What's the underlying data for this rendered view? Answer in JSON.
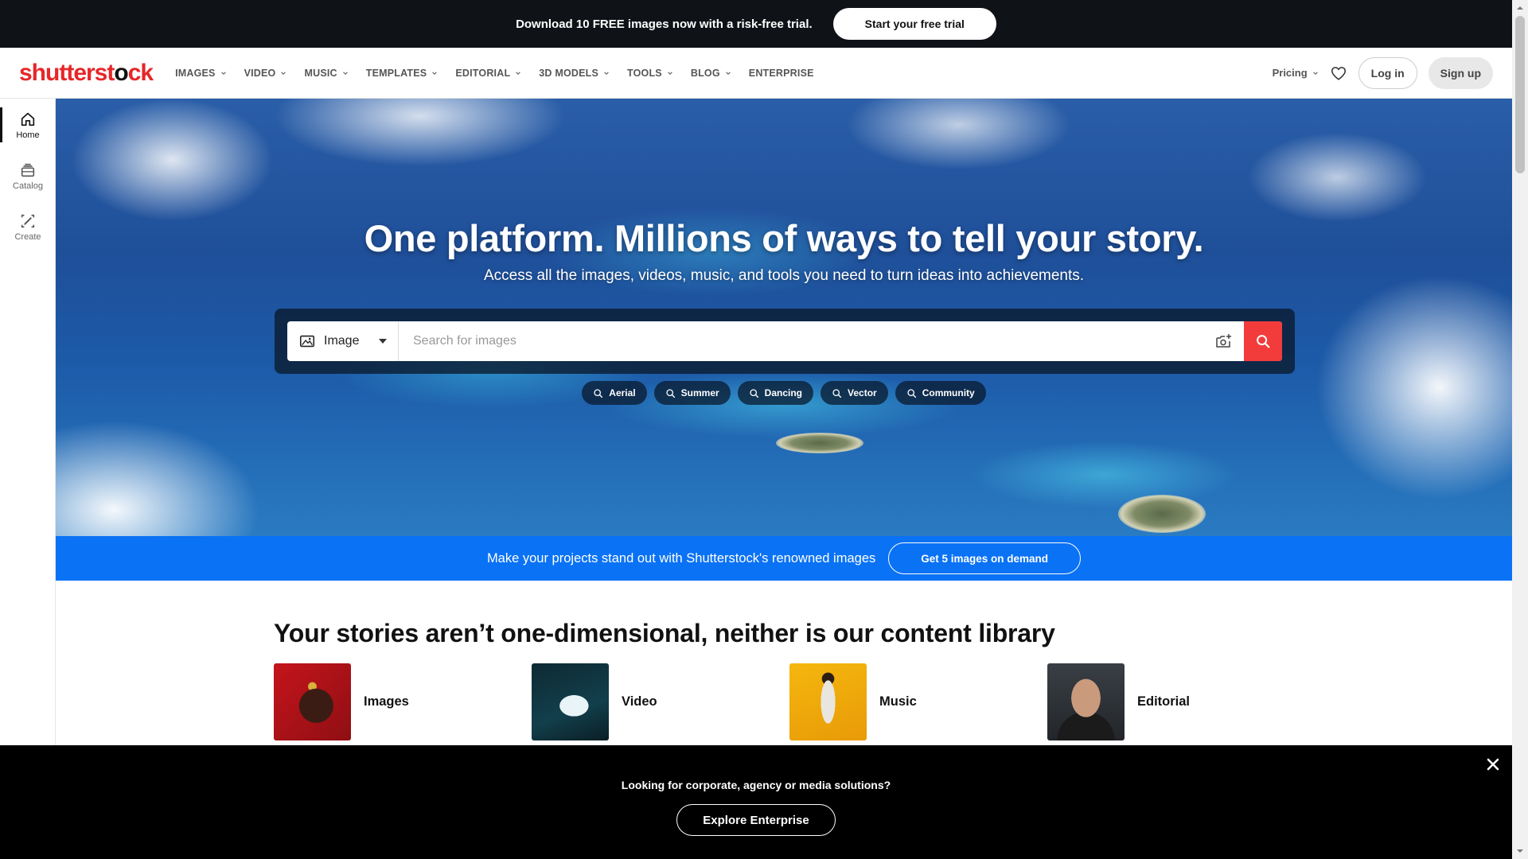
{
  "promo": {
    "text": "Download 10 FREE images now with a risk-free trial.",
    "button": "Start your free trial"
  },
  "header": {
    "logo_part1": "shutterst",
    "logo_o": "o",
    "logo_part2": "ck",
    "nav": [
      {
        "label": "IMAGES",
        "icon": "chevron-down-icon"
      },
      {
        "label": "VIDEO",
        "icon": "chevron-down-icon"
      },
      {
        "label": "MUSIC",
        "icon": "chevron-down-icon"
      },
      {
        "label": "TEMPLATES",
        "icon": "chevron-down-icon"
      },
      {
        "label": "EDITORIAL",
        "icon": "chevron-down-icon"
      },
      {
        "label": "3D MODELS",
        "icon": "chevron-down-icon"
      },
      {
        "label": "TOOLS",
        "icon": "chevron-down-icon"
      },
      {
        "label": "BLOG",
        "icon": "chevron-down-icon"
      },
      {
        "label": "ENTERPRISE"
      }
    ],
    "pricing": "Pricing",
    "login": "Log in",
    "signup": "Sign up"
  },
  "rail": [
    {
      "label": "Home",
      "icon": "home-icon",
      "active": true
    },
    {
      "label": "Catalog",
      "icon": "catalog-icon"
    },
    {
      "label": "Create",
      "icon": "create-icon"
    }
  ],
  "hero": {
    "title": "One platform. Millions of ways to tell your story.",
    "subtitle": "Access all the images, videos, music, and tools you need to turn ideas into achievements.",
    "search_type": "Image",
    "search_placeholder": "Search for images",
    "chips": [
      "Aerial",
      "Summer",
      "Dancing",
      "Vector",
      "Community"
    ]
  },
  "banner": {
    "text": "Make your projects stand out with Shutterstock's renowned images",
    "button": "Get 5 images on demand"
  },
  "content": {
    "title": "Your stories aren’t one-dimensional, neither is our content library",
    "cards": [
      {
        "label": "Images"
      },
      {
        "label": "Video"
      },
      {
        "label": "Music"
      },
      {
        "label": "Editorial"
      }
    ]
  },
  "enterprise": {
    "text": "Looking for corporate, agency or media solutions?",
    "button": "Explore Enterprise"
  },
  "colors": {
    "brand_red": "#e72628",
    "banner_blue": "#0a72f5",
    "search_red": "#f23c3c",
    "promo_bg": "#0f1318"
  }
}
